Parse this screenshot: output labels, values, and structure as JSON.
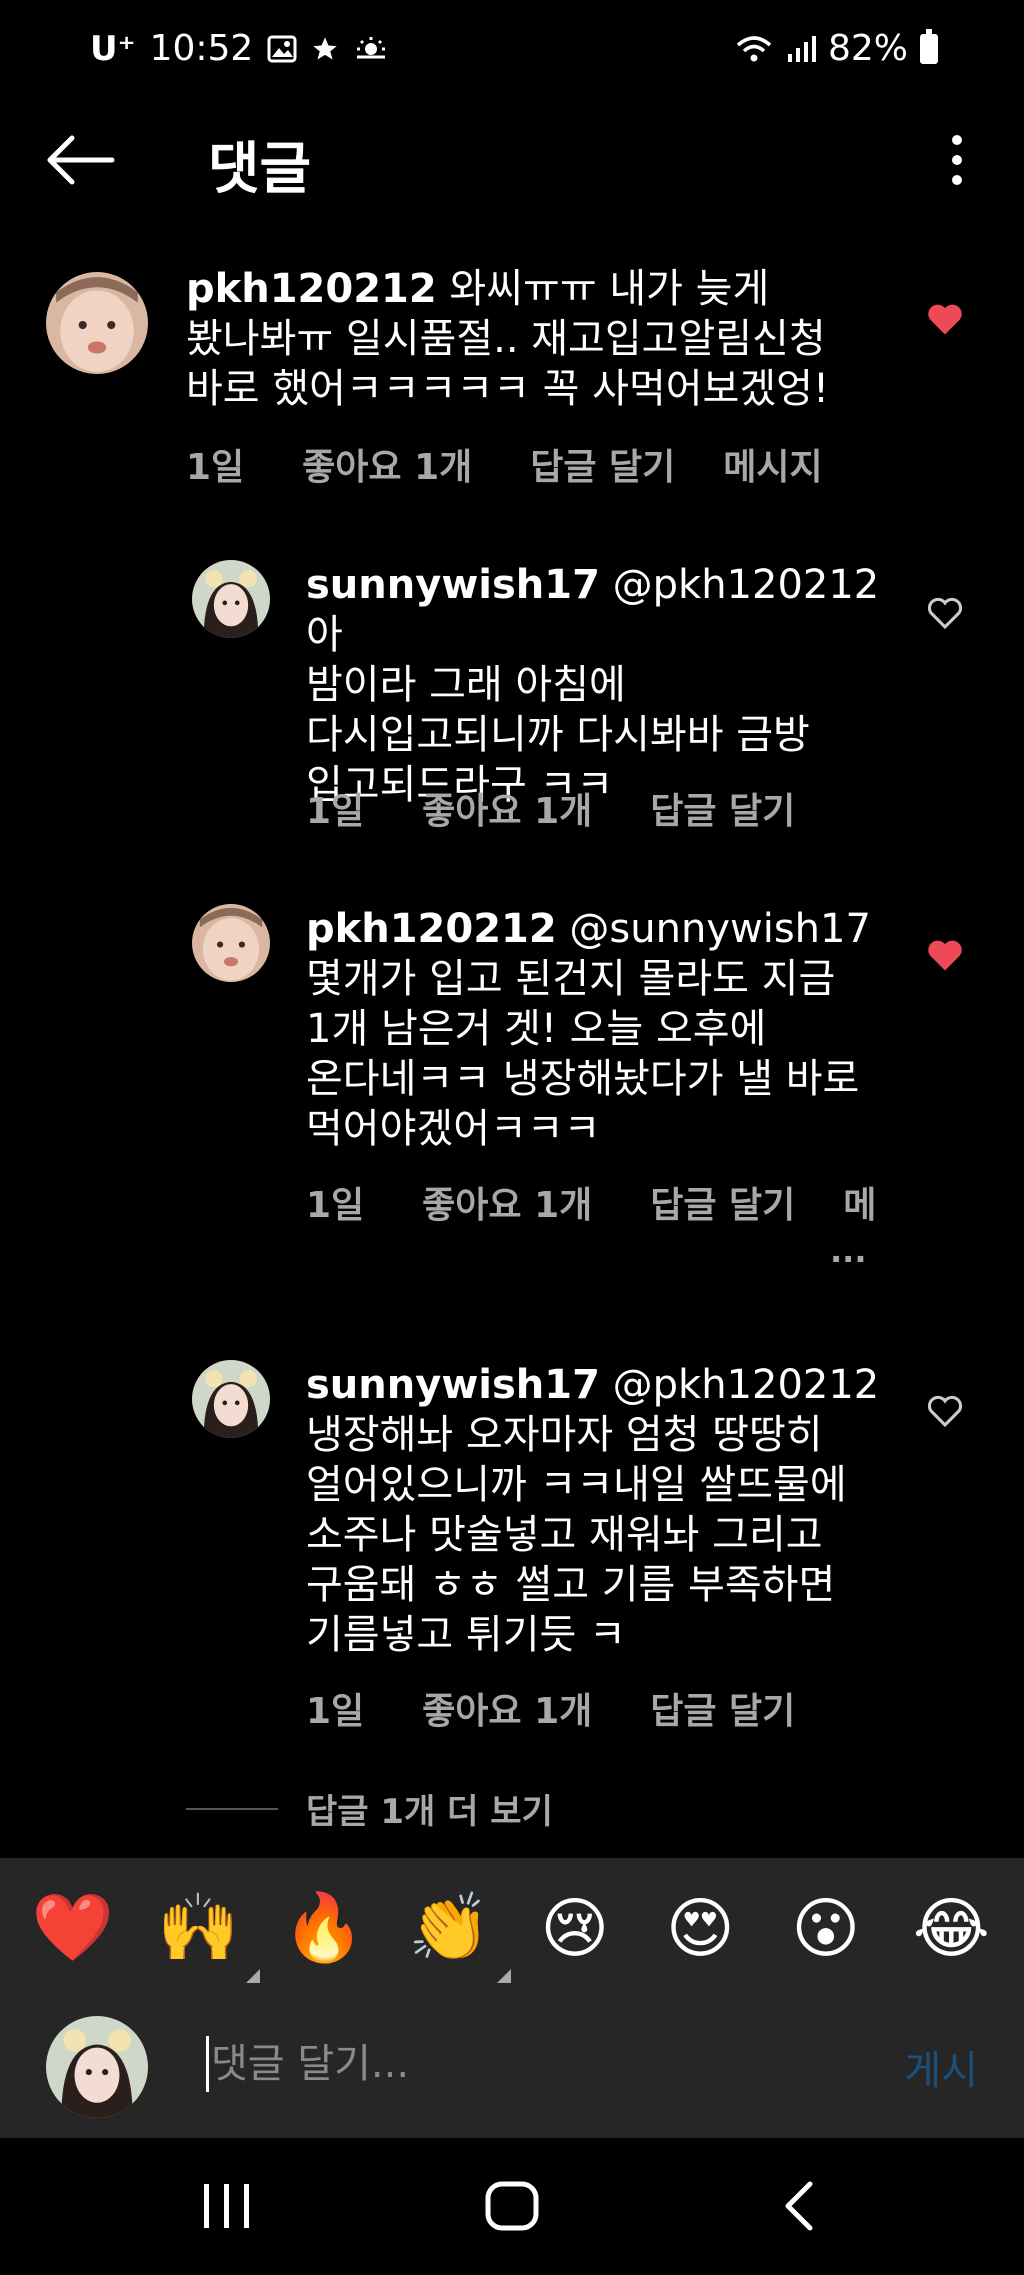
{
  "status_bar": {
    "carrier": "U⁺",
    "time": "10:52",
    "battery": "82%",
    "icons": [
      "image-icon",
      "star-icon",
      "weather-icon",
      "wifi-icon",
      "signal-icon",
      "battery-icon"
    ]
  },
  "header": {
    "title": "댓글"
  },
  "comments": [
    {
      "username": "pkh120212",
      "mention": "",
      "text": "와씨ㅠㅠ 내가 늦게",
      "lines": [
        "봤나봐ㅠ 일시품절.. 재고입고알림신청",
        "바로 했어ㅋㅋㅋㅋㅋ 꼭 사먹어보겠엉!"
      ],
      "time": "1일",
      "likes": "좋아요 1개",
      "reply": "답글 달기",
      "message": "메시지",
      "liked": true
    },
    {
      "username": "sunnywish17",
      "mention": "@pkh120212",
      "text": "아",
      "lines": [
        "밤이라 그래 아침에",
        "다시입고되니까 다시봐바 금방",
        "입고되드라구 ㅋㅋ"
      ],
      "time": "1일",
      "likes": "좋아요 1개",
      "reply": "답글 달기",
      "liked": false
    },
    {
      "username": "pkh120212",
      "mention": "@sunnywish17",
      "text": "",
      "lines": [
        "몇개가 입고 된건지 몰라도 지금",
        "1개 남은거 겟! 오늘 오후에",
        "온다네ㅋㅋ 냉장해놨다가 낼 바로",
        "먹어야겠어ㅋㅋㅋ"
      ],
      "time": "1일",
      "likes": "좋아요 1개",
      "reply": "답글 달기",
      "message": "메",
      "ellipsis": "...",
      "liked": true
    },
    {
      "username": "sunnywish17",
      "mention": "@pkh120212",
      "text": "",
      "lines": [
        "냉장해놔 오자마자 엄청 땅땅히",
        "얼어있으니까 ㅋㅋ내일 쌀뜨물에",
        "소주나 맛술넣고 재워놔 그리고",
        "구움돼 ㅎㅎ 썰고 기름 부족하면",
        "기름넣고 튀기듯 ㅋ"
      ],
      "time": "1일",
      "likes": "좋아요 1개",
      "reply": "답글 달기",
      "liked": false
    }
  ],
  "view_more": "답글 1개 더 보기",
  "emoji_bar": [
    "❤️",
    "🙌",
    "🔥",
    "👏",
    "😢",
    "😍",
    "😮",
    "😂"
  ],
  "input": {
    "placeholder": "댓글 달기...",
    "post_label": "게시"
  },
  "colors": {
    "background": "#000000",
    "liked_heart": "#ed4956",
    "meta_text": "#a8a8a8",
    "bottom_panel": "#262626",
    "post_button": "#1d4f7a"
  }
}
